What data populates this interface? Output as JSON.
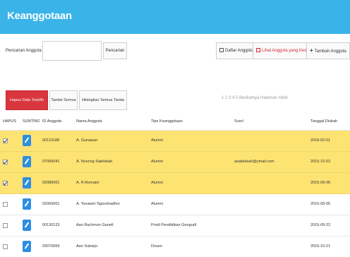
{
  "header": {
    "title": "Keanggotaan"
  },
  "search": {
    "label": "Pencarian Anggota :",
    "value": "",
    "button_label": "Pencarian"
  },
  "toolbar": {
    "list_label": "Daftar Anggota",
    "expired_label": "Lihat Anggota yang Kedaluwarsa",
    "add_label": "Tambah Anggota"
  },
  "actions": {
    "delete_selected": "Hapus Data Terpilih",
    "mark_all": "Tandai Semua",
    "unmark_all": "Hilangkan Semua Tanda"
  },
  "pagination": {
    "text": "1  2  3  4  5  Berikutnya  Halaman Akhir"
  },
  "table": {
    "columns": [
      "HAPUS",
      "SUNTING",
      "ID Anggota",
      "Nama Anggota",
      "Tipe Keanggotaan",
      "Surel",
      "Tanggal Diubah"
    ],
    "rows": [
      {
        "selected": true,
        "id": "00110188",
        "name": "A. Gunawan",
        "type": "Alumni",
        "email": "",
        "updated": "2018-02-01"
      },
      {
        "selected": true,
        "id": "07090041",
        "name": "A. Novong Salelekah",
        "type": "Alumni",
        "email": "asalelekah@ymail.com",
        "updated": "2015-10-02"
      },
      {
        "selected": true,
        "id": "02080001",
        "name": "A. R.Romaini",
        "type": "Alumni",
        "email": "",
        "updated": "2015-09-06"
      },
      {
        "selected": false,
        "id": "02060001",
        "name": "A. Tonawet Taporshadhoi",
        "type": "Alumni",
        "email": "",
        "updated": "2015-09-05"
      },
      {
        "selected": false,
        "id": "00130123",
        "name": "Aan Rachmon Ganefi",
        "type": "Prodi Pendidikan Geografi",
        "email": "",
        "updated": "2015-09-22"
      },
      {
        "selected": false,
        "id": "03070069",
        "name": "Aan Subarjo",
        "type": "Dosen",
        "email": "",
        "updated": "2015-10-21"
      }
    ]
  },
  "colors": {
    "header": "#39b3e8",
    "selected_row": "#fde372",
    "danger": "#d9363e",
    "edit": "#2d8ee2"
  }
}
